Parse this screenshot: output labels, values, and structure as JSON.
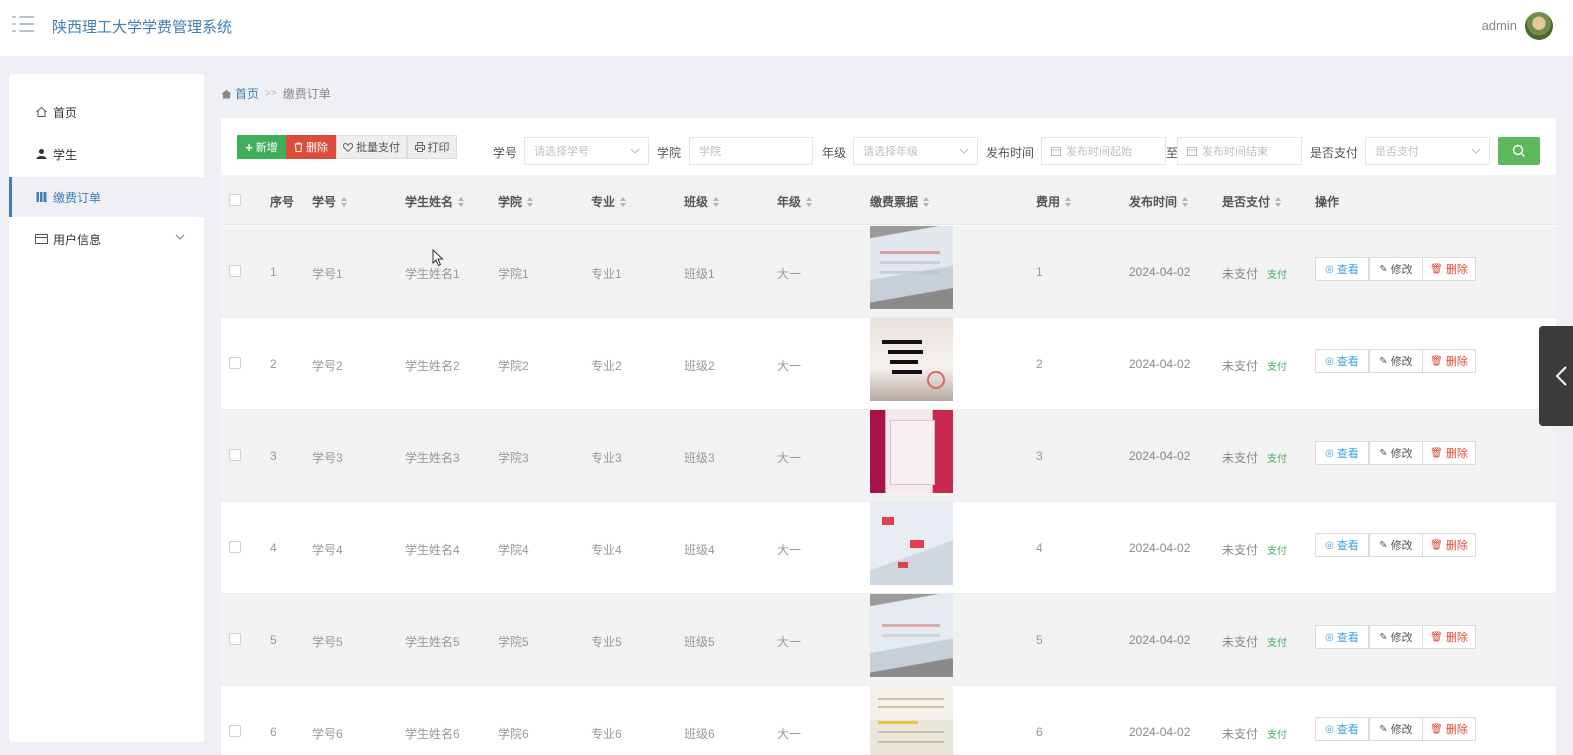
{
  "header": {
    "app_title": "陕西理工大学学费管理系统",
    "user_name": "admin",
    "menu_icon": "menu-icon",
    "avatar_icon": "user-avatar"
  },
  "sidebar": {
    "items": [
      {
        "label": "首页",
        "icon": "home-icon"
      },
      {
        "label": "学生",
        "icon": "user-icon"
      },
      {
        "label": "缴费订单",
        "icon": "book-icon",
        "active": true
      },
      {
        "label": "用户信息",
        "icon": "card-icon",
        "expandable": true
      }
    ]
  },
  "breadcrumb": {
    "home": "首页",
    "separator": ">>",
    "current": "缴费订单"
  },
  "toolbar": {
    "add": "新增",
    "delete": "删除",
    "batch_pay": "批量支付",
    "print": "打印"
  },
  "filters": {
    "student_id": {
      "label": "学号",
      "placeholder": "请选择学号"
    },
    "college": {
      "label": "学院",
      "placeholder": "学院"
    },
    "grade": {
      "label": "年级",
      "placeholder": "请选择年级"
    },
    "publish_time": {
      "label": "发布时间",
      "start_placeholder": "发布时间起始",
      "to": "至",
      "end_placeholder": "发布时间结束"
    },
    "paid": {
      "label": "是否支付",
      "placeholder": "是否支付"
    }
  },
  "table": {
    "columns": [
      "序号",
      "学号",
      "学生姓名",
      "学院",
      "专业",
      "班级",
      "年级",
      "缴费票据",
      "费用",
      "发布时间",
      "是否支付",
      "操作"
    ],
    "rows": [
      {
        "no": "1",
        "student_id": "学号1",
        "name": "学生姓名1",
        "college": "学院1",
        "major": "专业1",
        "class": "班级1",
        "grade": "大一",
        "fee": "1",
        "time": "2024-04-02",
        "paid": "未支付",
        "pay_link": "支付"
      },
      {
        "no": "2",
        "student_id": "学号2",
        "name": "学生姓名2",
        "college": "学院2",
        "major": "专业2",
        "class": "班级2",
        "grade": "大一",
        "fee": "2",
        "time": "2024-04-02",
        "paid": "未支付",
        "pay_link": "支付"
      },
      {
        "no": "3",
        "student_id": "学号3",
        "name": "学生姓名3",
        "college": "学院3",
        "major": "专业3",
        "class": "班级3",
        "grade": "大一",
        "fee": "3",
        "time": "2024-04-02",
        "paid": "未支付",
        "pay_link": "支付"
      },
      {
        "no": "4",
        "student_id": "学号4",
        "name": "学生姓名4",
        "college": "学院4",
        "major": "专业4",
        "class": "班级4",
        "grade": "大一",
        "fee": "4",
        "time": "2024-04-02",
        "paid": "未支付",
        "pay_link": "支付"
      },
      {
        "no": "5",
        "student_id": "学号5",
        "name": "学生姓名5",
        "college": "学院5",
        "major": "专业5",
        "class": "班级5",
        "grade": "大一",
        "fee": "5",
        "time": "2024-04-02",
        "paid": "未支付",
        "pay_link": "支付"
      },
      {
        "no": "6",
        "student_id": "学号6",
        "name": "学生姓名6",
        "college": "学院6",
        "major": "专业6",
        "class": "班级6",
        "grade": "大一",
        "fee": "6",
        "time": "2024-04-02",
        "paid": "未支付",
        "pay_link": "支付"
      }
    ],
    "actions": {
      "view": "查看",
      "edit": "修改",
      "delete": "删除"
    }
  },
  "colors": {
    "accent": "#3f7fb5",
    "add_button": "#3eaf5a",
    "delete_button": "#dd4b39",
    "search_button": "#5cb85c"
  }
}
